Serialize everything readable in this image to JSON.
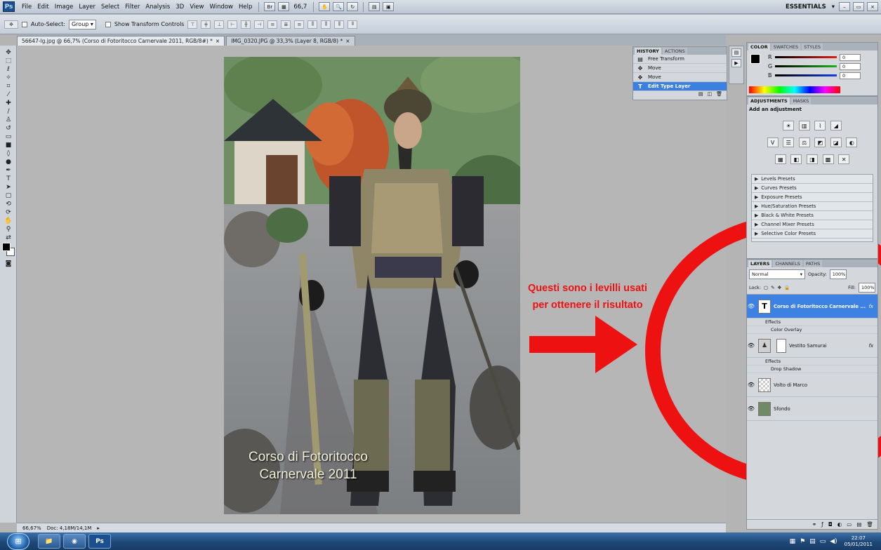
{
  "app": {
    "logo": "Ps"
  },
  "menubar": {
    "items": [
      "File",
      "Edit",
      "Image",
      "Layer",
      "Select",
      "Filter",
      "Analysis",
      "3D",
      "View",
      "Window",
      "Help"
    ],
    "zoom_value": "66,7",
    "workspace_label": "ESSENTIALS",
    "workspace_arrow": "▾"
  },
  "options_bar": {
    "auto_select_label": "Auto-Select:",
    "auto_select_value": "Group",
    "show_transform_label": "Show Transform Controls"
  },
  "doc_tabs": [
    {
      "label": "56647-lg.jpg @ 66,7% (Corso di Fotoritocco Carnervale 2011, RGB/8#) *",
      "close": "×"
    },
    {
      "label": "IMG_0320.JPG @ 33,3% (Layer 8, RGB/8) *",
      "close": "×"
    }
  ],
  "canvas": {
    "caption_line1": "Corso di Fotoritocco",
    "caption_line2": "Carnervale 2011"
  },
  "annotation": {
    "line1": "Questi sono i levilli usati",
    "line2": "per ottenere il risultato",
    "color": "#ee1111"
  },
  "status": {
    "zoom": "66,67%",
    "doc": "Doc: 4,18M/14,1M"
  },
  "history_panel": {
    "tabs": [
      "HISTORY",
      "ACTIONS"
    ],
    "rows": [
      {
        "label": "Free Transform",
        "icon": "▤"
      },
      {
        "label": "Move",
        "icon": "✥"
      },
      {
        "label": "Move",
        "icon": "✥"
      },
      {
        "label": "Edit Type Layer",
        "icon": "T",
        "selected": true
      }
    ]
  },
  "color_panel": {
    "tabs": [
      "COLOR",
      "SWATCHES",
      "STYLES"
    ],
    "sliders": [
      {
        "label": "R",
        "value": "0",
        "color": "#e21a1a"
      },
      {
        "label": "G",
        "value": "0",
        "color": "#19b319"
      },
      {
        "label": "B",
        "value": "0",
        "color": "#1a3fe2"
      }
    ]
  },
  "adjustments_panel": {
    "tabs": [
      "ADJUSTMENTS",
      "MASKS"
    ],
    "title": "Add an adjustment",
    "icon_rows": [
      [
        "☀",
        "▥",
        "⌇",
        "◢"
      ],
      [
        "V",
        "☰",
        "⚖",
        "◩",
        "◪",
        "◐"
      ],
      [
        "▦",
        "◧",
        "◨",
        "▩",
        "✕"
      ]
    ],
    "presets": [
      "Levels Presets",
      "Curves Presets",
      "Exposure Presets",
      "Hue/Saturation Presets",
      "Black & White Presets",
      "Channel Mixer Presets",
      "Selective Color Presets"
    ]
  },
  "layers_panel": {
    "tabs": [
      "LAYERS",
      "CHANNELS",
      "PATHS"
    ],
    "blend_mode": "Normal",
    "opacity_label": "Opacity:",
    "opacity_value": "100%",
    "lock_label": "Lock:",
    "fill_label": "Fill:",
    "fill_value": "100%",
    "layers": [
      {
        "name": "Corso di Fotoritocco Carnervale ...",
        "thumb": "T",
        "fx": "fx",
        "selected": true,
        "effects_label": "Effects",
        "effects": [
          "Color Overlay"
        ]
      },
      {
        "name": "Vestito Samurai",
        "thumb": "",
        "fx": "fx",
        "selected": false,
        "effects_label": "Effects",
        "effects": [
          "Drop Shadow"
        ]
      },
      {
        "name": "Volto di Marco",
        "thumb": "",
        "fx": "",
        "selected": false,
        "effects_label": "",
        "effects": []
      },
      {
        "name": "Sfondo",
        "thumb": "",
        "fx": "",
        "selected": false,
        "effects_label": "",
        "effects": []
      }
    ]
  },
  "taskbar": {
    "time": "22:07",
    "date": "05/01/2011",
    "ps_label": "Ps"
  }
}
